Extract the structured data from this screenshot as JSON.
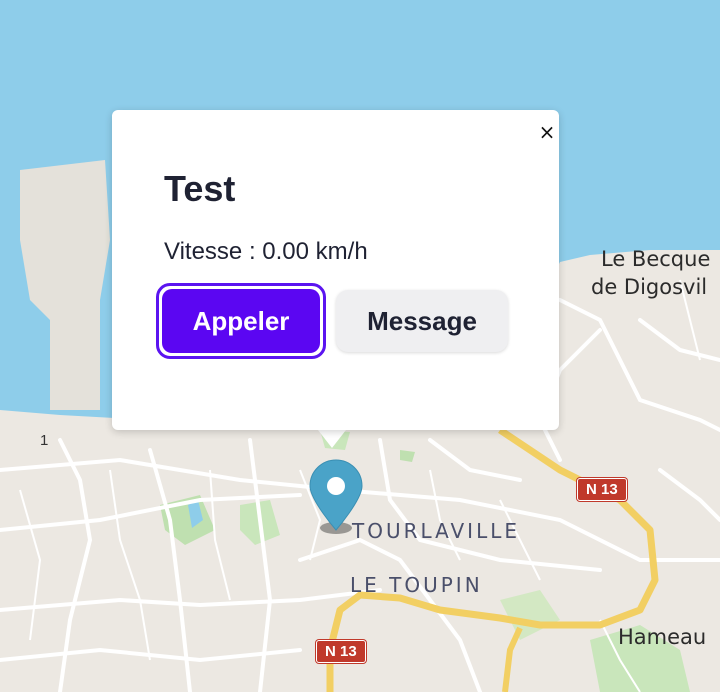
{
  "popup": {
    "title": "Test",
    "speed_text": "Vitesse : 0.00 km/h",
    "call_label": "Appeler",
    "message_label": "Message",
    "close_label": "×"
  },
  "map": {
    "places": {
      "tourlaville": "TOURLAVILLE",
      "le_toupin": "LE TOUPIN",
      "le_becquet_line1": "Le Becque",
      "le_becquet_line2": "de Digosvil",
      "hameau": "Hameau"
    },
    "roads": {
      "n13_top": "N 13",
      "n13_bottom": "N 13",
      "route_1": "1"
    },
    "marker_icon": "map-pin-icon"
  },
  "colors": {
    "sea": "#8ecdea",
    "land": "#ece8e2",
    "marker": "#4aa3c8",
    "primary_button": "#5b06f2",
    "road_shield": "#c0392b",
    "major_road": "#f2cf63"
  }
}
